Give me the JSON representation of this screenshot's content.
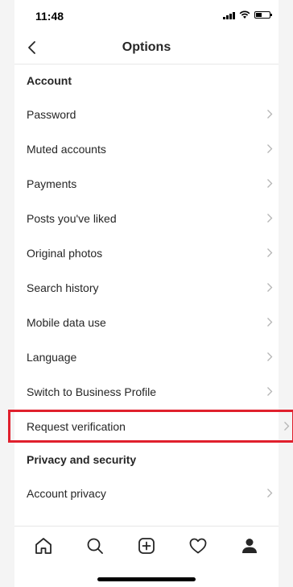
{
  "status_bar": {
    "time": "11:48"
  },
  "header": {
    "title": "Options",
    "back_icon": "chevron-left-icon"
  },
  "sections": [
    {
      "title": "Account",
      "items": [
        "Password",
        "Muted accounts",
        "Payments",
        "Posts you've liked",
        "Original photos",
        "Search history",
        "Mobile data use",
        "Language",
        "Switch to Business Profile",
        "Request verification"
      ]
    },
    {
      "title": "Privacy and security",
      "items": [
        "Account privacy"
      ]
    }
  ],
  "highlighted_item": "Request verification",
  "highlight_color": "#e0202d",
  "tab_bar": {
    "icons": [
      "home-icon",
      "search-icon",
      "add-post-icon",
      "heart-icon",
      "profile-icon"
    ]
  }
}
